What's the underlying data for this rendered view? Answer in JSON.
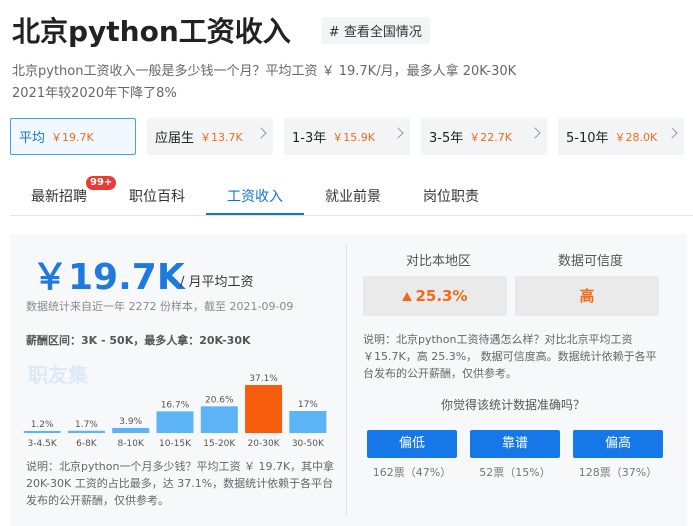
{
  "header": {
    "title": "北京python工资收入",
    "tag": "# 查看全国情况"
  },
  "summary": {
    "line1": "北京python工资收入一般是多少钱一个月？平均工资 ￥ 19.7K/月，最多人拿 20K-30K",
    "line2": "2021年较2020年下降了8%"
  },
  "levels": [
    {
      "name": "平均",
      "value": "￥19.7K"
    },
    {
      "name": "应届生",
      "value": "￥13.7K"
    },
    {
      "name": "1-3年",
      "value": "￥15.9K"
    },
    {
      "name": "3-5年",
      "value": "￥22.7K"
    },
    {
      "name": "5-10年",
      "value": "￥28.0K"
    }
  ],
  "tabs": [
    {
      "label": "最新招聘",
      "badge": "99+"
    },
    {
      "label": "职位百科"
    },
    {
      "label": "工资收入"
    },
    {
      "label": "就业前景"
    },
    {
      "label": "岗位职责"
    }
  ],
  "salary": {
    "amount": "￥19.7K",
    "unit": "/ 月平均工资",
    "sample_note": "数据统计来自近一年 2272 份样本，截至 2021-09-09",
    "range_text": "薪酬区间：3K - 50K，最多人拿：20K-30K",
    "watermark": "职友集",
    "note": "说明：北京python一个月多少钱？平均工资 ￥ 19.7K，其中拿20K-30K 工资的占比最多，达 37.1%，数据统计依赖于各平台发布的公开薪酬，仅供参考。"
  },
  "chart_data": {
    "type": "bar",
    "categories": [
      "3-4.5K",
      "6-8K",
      "8-10K",
      "10-15K",
      "15-20K",
      "20-30K",
      "30-50K"
    ],
    "values": [
      1.2,
      1.7,
      3.9,
      16.7,
      20.6,
      37.1,
      17
    ],
    "labels": [
      "1.2%",
      "1.7%",
      "3.9%",
      "16.7%",
      "20.6%",
      "37.1%",
      "17%"
    ],
    "highlight_index": 5,
    "ylim": [
      0,
      37.1
    ],
    "colors": {
      "normal": "#5cb3f5",
      "highlight": "#f55d0c"
    }
  },
  "comparison": {
    "local_label": "对比本地区",
    "local_value": "25.3%",
    "trust_label": "数据可信度",
    "trust_value": "高",
    "explain": "说明：北京python工资待遇怎么样？对比北京平均工资 ￥15.7K，高 25.3%， 数据可信度高。数据统计依赖于各平台发布的公开薪酬，仅供参考。",
    "ask": "你觉得该统计数据准确吗？",
    "votes": [
      {
        "label": "偏低",
        "count": "162票（47%）"
      },
      {
        "label": "靠谱",
        "count": "52票（15%）"
      },
      {
        "label": "偏高",
        "count": "128票（37%）"
      }
    ]
  },
  "colors": {
    "accent": "#1276d8",
    "orange": "#f26b1d"
  }
}
